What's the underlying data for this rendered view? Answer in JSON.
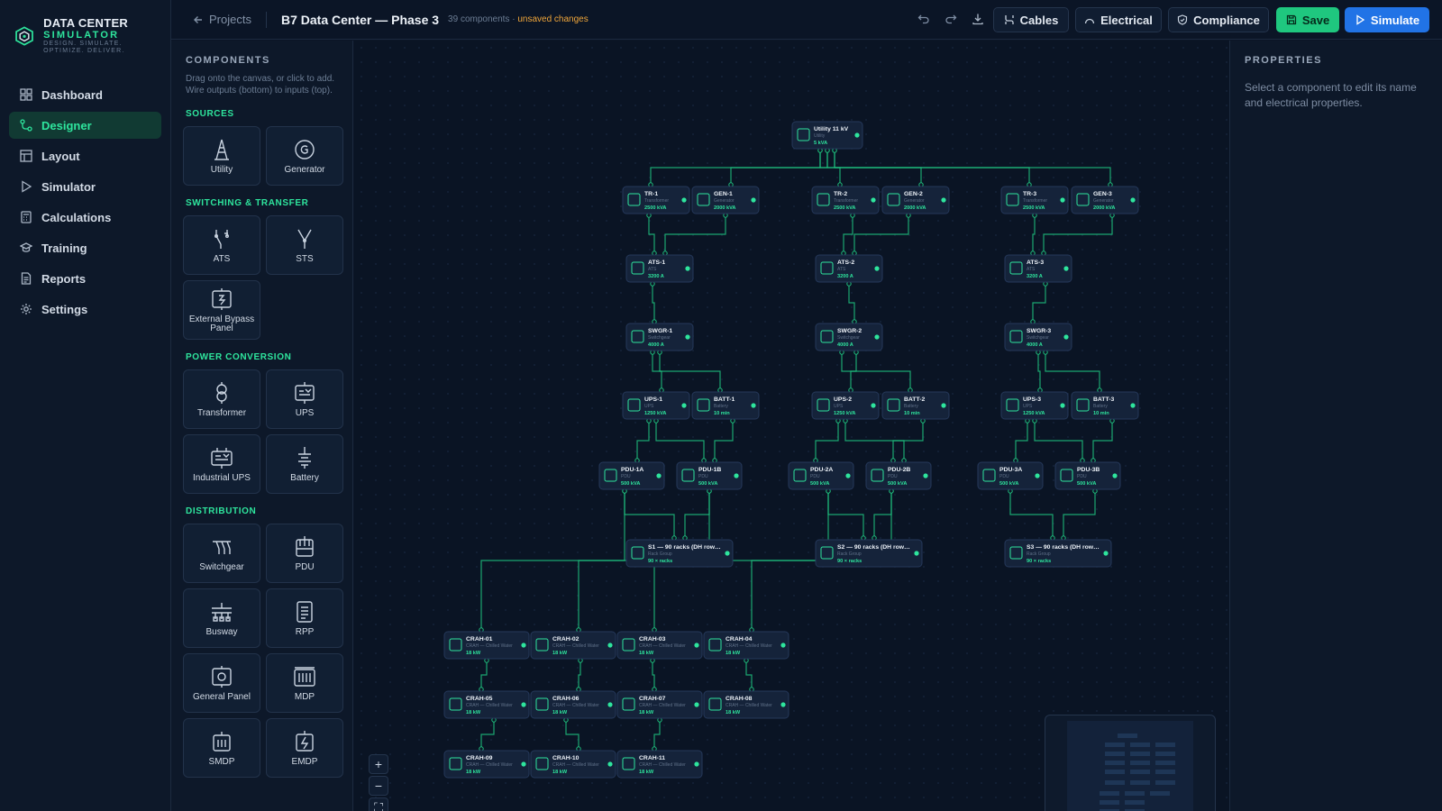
{
  "app": {
    "title_line1": "DATA CENTER",
    "title_line2": "SIMULATOR",
    "tagline": "DESIGN. SIMULATE. OPTIMIZE. DELIVER."
  },
  "nav": [
    {
      "label": "Dashboard",
      "icon": "grid-icon"
    },
    {
      "label": "Designer",
      "icon": "flow-icon",
      "active": true
    },
    {
      "label": "Layout",
      "icon": "layout-icon"
    },
    {
      "label": "Simulator",
      "icon": "play-icon"
    },
    {
      "label": "Calculations",
      "icon": "calculator-icon"
    },
    {
      "label": "Training",
      "icon": "graduation-icon"
    },
    {
      "label": "Reports",
      "icon": "report-icon"
    },
    {
      "label": "Settings",
      "icon": "gear-icon"
    }
  ],
  "topbar": {
    "back_label": "Projects",
    "project_title": "B7 Data Center — Phase 3",
    "component_count": "39 components",
    "separator": "·",
    "unsaved": "unsaved changes",
    "buttons": {
      "cables": "Cables",
      "electrical": "Electrical",
      "compliance": "Compliance",
      "save": "Save",
      "simulate": "Simulate"
    }
  },
  "palette": {
    "title": "COMPONENTS",
    "hint": "Drag onto the canvas, or click to add. Wire outputs (bottom) to inputs (top).",
    "sections": [
      {
        "title": "SOURCES",
        "items": [
          {
            "label": "Utility",
            "icon": "utility-tower-icon"
          },
          {
            "label": "Generator",
            "icon": "generator-icon"
          }
        ]
      },
      {
        "title": "SWITCHING & TRANSFER",
        "items": [
          {
            "label": "ATS",
            "icon": "ats-switch-icon"
          },
          {
            "label": "STS",
            "icon": "sts-switch-icon"
          },
          {
            "label": "External Bypass Panel",
            "icon": "bypass-panel-icon"
          }
        ]
      },
      {
        "title": "POWER CONVERSION",
        "items": [
          {
            "label": "Transformer",
            "icon": "transformer-icon"
          },
          {
            "label": "UPS",
            "icon": "ups-icon"
          },
          {
            "label": "Industrial UPS",
            "icon": "industrial-ups-icon"
          },
          {
            "label": "Battery",
            "icon": "battery-icon"
          }
        ]
      },
      {
        "title": "DISTRIBUTION",
        "items": [
          {
            "label": "Switchgear",
            "icon": "switchgear-icon"
          },
          {
            "label": "PDU",
            "icon": "pdu-icon"
          },
          {
            "label": "Busway",
            "icon": "busway-icon"
          },
          {
            "label": "RPP",
            "icon": "rpp-icon"
          },
          {
            "label": "General Panel",
            "icon": "general-panel-icon"
          },
          {
            "label": "MDP",
            "icon": "mdp-icon"
          },
          {
            "label": "SMDP",
            "icon": "smdp-icon"
          },
          {
            "label": "EMDP",
            "icon": "emdp-icon"
          }
        ]
      }
    ]
  },
  "diagram": {
    "nodes": [
      {
        "id": "utility",
        "name": "Utility 11 kV",
        "type": "Utility",
        "rating": "5 kVA"
      },
      {
        "id": "tr1",
        "name": "TR-1",
        "type": "Transformer",
        "rating": "2500 kVA"
      },
      {
        "id": "gen1",
        "name": "GEN-1",
        "type": "Generator",
        "rating": "2000 kVA"
      },
      {
        "id": "tr2",
        "name": "TR-2",
        "type": "Transformer",
        "rating": "2500 kVA"
      },
      {
        "id": "gen2",
        "name": "GEN-2",
        "type": "Generator",
        "rating": "2000 kVA"
      },
      {
        "id": "tr3",
        "name": "TR-3",
        "type": "Transformer",
        "rating": "2500 kVA"
      },
      {
        "id": "gen3",
        "name": "GEN-3",
        "type": "Generator",
        "rating": "2000 kVA"
      },
      {
        "id": "ats1",
        "name": "ATS-1",
        "type": "ATS",
        "rating": "3200 A"
      },
      {
        "id": "ats2",
        "name": "ATS-2",
        "type": "ATS",
        "rating": "3200 A"
      },
      {
        "id": "ats3",
        "name": "ATS-3",
        "type": "ATS",
        "rating": "3200 A"
      },
      {
        "id": "swgr1",
        "name": "SWGR-1",
        "type": "Switchgear",
        "rating": "4000 A"
      },
      {
        "id": "swgr2",
        "name": "SWGR-2",
        "type": "Switchgear",
        "rating": "4000 A"
      },
      {
        "id": "swgr3",
        "name": "SWGR-3",
        "type": "Switchgear",
        "rating": "4000 A"
      },
      {
        "id": "ups1",
        "name": "UPS-1",
        "type": "UPS",
        "rating": "1250 kVA"
      },
      {
        "id": "batt1",
        "name": "BATT-1",
        "type": "Battery",
        "rating": "10 min"
      },
      {
        "id": "ups2",
        "name": "UPS-2",
        "type": "UPS",
        "rating": "1250 kVA"
      },
      {
        "id": "batt2",
        "name": "BATT-2",
        "type": "Battery",
        "rating": "10 min"
      },
      {
        "id": "ups3",
        "name": "UPS-3",
        "type": "UPS",
        "rating": "1250 kVA"
      },
      {
        "id": "batt3",
        "name": "BATT-3",
        "type": "Battery",
        "rating": "10 min"
      },
      {
        "id": "pdu1a",
        "name": "PDU-1A",
        "type": "PDU",
        "rating": "500 kVA"
      },
      {
        "id": "pdu1b",
        "name": "PDU-1B",
        "type": "PDU",
        "rating": "500 kVA"
      },
      {
        "id": "pdu2a",
        "name": "PDU-2A",
        "type": "PDU",
        "rating": "500 kVA"
      },
      {
        "id": "pdu2b",
        "name": "PDU-2B",
        "type": "PDU",
        "rating": "500 kVA"
      },
      {
        "id": "pdu3a",
        "name": "PDU-3A",
        "type": "PDU",
        "rating": "500 kVA"
      },
      {
        "id": "pdu3b",
        "name": "PDU-3B",
        "type": "PDU",
        "rating": "500 kVA"
      },
      {
        "id": "s1",
        "name": "S1 — 90 racks (DH row…",
        "type": "Rack Group",
        "rating": "90 × racks"
      },
      {
        "id": "s2",
        "name": "S2 — 90 racks (DH row…",
        "type": "Rack Group",
        "rating": "90 × racks"
      },
      {
        "id": "s3",
        "name": "S3 — 90 racks (DH row…",
        "type": "Rack Group",
        "rating": "90 × racks"
      },
      {
        "id": "crah01",
        "name": "CRAH-01",
        "type": "CRAH — Chilled Water",
        "rating": "18 kW"
      },
      {
        "id": "crah02",
        "name": "CRAH-02",
        "type": "CRAH — Chilled Water",
        "rating": "18 kW"
      },
      {
        "id": "crah03",
        "name": "CRAH-03",
        "type": "CRAH — Chilled Water",
        "rating": "18 kW"
      },
      {
        "id": "crah04",
        "name": "CRAH-04",
        "type": "CRAH — Chilled Water",
        "rating": "18 kW"
      },
      {
        "id": "crah05",
        "name": "CRAH-05",
        "type": "CRAH — Chilled Water",
        "rating": "18 kW"
      },
      {
        "id": "crah06",
        "name": "CRAH-06",
        "type": "CRAH — Chilled Water",
        "rating": "18 kW"
      },
      {
        "id": "crah07",
        "name": "CRAH-07",
        "type": "CRAH — Chilled Water",
        "rating": "18 kW"
      },
      {
        "id": "crah08",
        "name": "CRAH-08",
        "type": "CRAH — Chilled Water",
        "rating": "18 kW"
      },
      {
        "id": "crah09",
        "name": "CRAH-09",
        "type": "CRAH — Chilled Water",
        "rating": "18 kW"
      },
      {
        "id": "crah10",
        "name": "CRAH-10",
        "type": "CRAH — Chilled Water",
        "rating": "18 kW"
      },
      {
        "id": "crah11",
        "name": "CRAH-11",
        "type": "CRAH — Chilled Water",
        "rating": "18 kW"
      }
    ],
    "edges": [
      [
        "utility",
        "tr1"
      ],
      [
        "utility",
        "gen1"
      ],
      [
        "utility",
        "tr2"
      ],
      [
        "utility",
        "gen2"
      ],
      [
        "utility",
        "tr3"
      ],
      [
        "utility",
        "gen3"
      ],
      [
        "tr1",
        "ats1"
      ],
      [
        "gen1",
        "ats1"
      ],
      [
        "tr2",
        "ats2"
      ],
      [
        "gen2",
        "ats2"
      ],
      [
        "tr3",
        "ats3"
      ],
      [
        "gen3",
        "ats3"
      ],
      [
        "ats1",
        "swgr1"
      ],
      [
        "ats2",
        "swgr2"
      ],
      [
        "ats3",
        "swgr3"
      ],
      [
        "swgr1",
        "ups1"
      ],
      [
        "swgr1",
        "batt1"
      ],
      [
        "swgr2",
        "ups2"
      ],
      [
        "swgr2",
        "batt2"
      ],
      [
        "swgr3",
        "ups3"
      ],
      [
        "swgr3",
        "batt3"
      ],
      [
        "ups1",
        "pdu1a"
      ],
      [
        "ups1",
        "pdu1b"
      ],
      [
        "batt1",
        "pdu1b"
      ],
      [
        "ups2",
        "pdu2a"
      ],
      [
        "ups2",
        "pdu2b"
      ],
      [
        "batt2",
        "pdu2b"
      ],
      [
        "ups3",
        "pdu3a"
      ],
      [
        "ups3",
        "pdu3b"
      ],
      [
        "batt3",
        "pdu3b"
      ],
      [
        "pdu1a",
        "s1"
      ],
      [
        "pdu1b",
        "s1"
      ],
      [
        "pdu2a",
        "s2"
      ],
      [
        "pdu2b",
        "s2"
      ],
      [
        "pdu3a",
        "s3"
      ],
      [
        "pdu3b",
        "s3"
      ],
      [
        "pdu1a",
        "crah01"
      ],
      [
        "pdu1b",
        "crah02"
      ],
      [
        "pdu2a",
        "crah03"
      ],
      [
        "pdu2b",
        "crah04"
      ],
      [
        "crah01",
        "crah05"
      ],
      [
        "crah02",
        "crah06"
      ],
      [
        "crah03",
        "crah07"
      ],
      [
        "crah04",
        "crah08"
      ],
      [
        "crah05",
        "crah09"
      ],
      [
        "crah06",
        "crah10"
      ],
      [
        "crah07",
        "crah11"
      ]
    ]
  },
  "properties": {
    "title": "PROPERTIES",
    "hint": "Select a component to edit its name and electrical properties."
  },
  "zoom": {
    "in": "+",
    "out": "−",
    "fit": "⛶"
  },
  "colors": {
    "accent": "#2ee59d",
    "wire": "#1fbf7e",
    "warning": "#f0a63a",
    "primary": "#2173e6"
  }
}
